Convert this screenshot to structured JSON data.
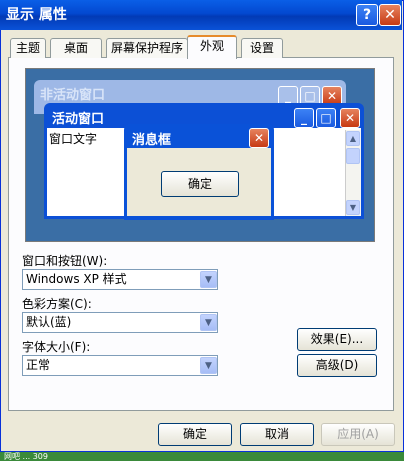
{
  "window": {
    "title": "显示 属性",
    "help_label": "?",
    "close_label": "✕"
  },
  "tabs": [
    {
      "label": "主题"
    },
    {
      "label": "桌面"
    },
    {
      "label": "屏幕保护程序"
    },
    {
      "label": "外观"
    },
    {
      "label": "设置"
    }
  ],
  "active_tab": "外观",
  "preview": {
    "inactive_title": "非活动窗口",
    "active_title": "活动窗口",
    "window_text": "窗口文字",
    "message_title": "消息框",
    "message_ok": "确定"
  },
  "form": {
    "windows_buttons_label": "窗口和按钮(W):",
    "windows_buttons_value": "Windows XP 样式",
    "color_scheme_label": "色彩方案(C):",
    "color_scheme_value": "默认(蓝)",
    "font_size_label": "字体大小(F):",
    "font_size_value": "正常",
    "effects_button": "效果(E)...",
    "advanced_button": "高级(D)"
  },
  "footer": {
    "ok": "确定",
    "cancel": "取消",
    "apply": "应用(A)"
  },
  "taskbar": {
    "text": "网吧 ... 309"
  },
  "colors": {
    "title_blue": "#0348d0",
    "dialog_bg": "#ece9d8",
    "desktop_preview": "#3a6ea5"
  }
}
